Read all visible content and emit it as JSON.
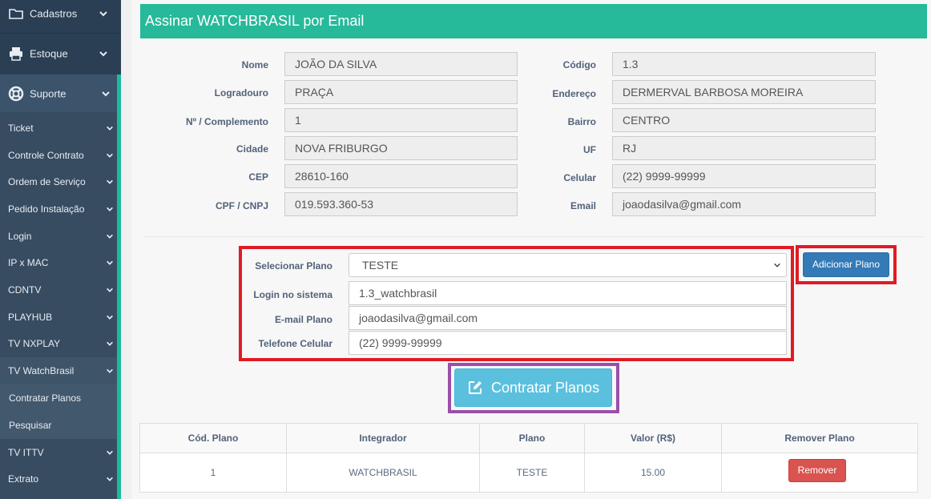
{
  "sidebar": {
    "top_items": [
      {
        "label": "Cadastros",
        "icon": "folder-icon"
      },
      {
        "label": "Estoque",
        "icon": "printer-icon"
      },
      {
        "label": "Suporte",
        "icon": "life-ring-icon"
      }
    ],
    "sub_items": [
      {
        "label": "Ticket"
      },
      {
        "label": "Controle Contrato"
      },
      {
        "label": "Ordem de Serviço"
      },
      {
        "label": "Pedido Instalação"
      },
      {
        "label": "Login"
      },
      {
        "label": "IP x MAC"
      },
      {
        "label": "CDNTV"
      },
      {
        "label": "PLAYHUB"
      },
      {
        "label": "TV NXPLAY"
      },
      {
        "label": "TV WatchBrasil"
      },
      {
        "label": "Contratar Planos"
      },
      {
        "label": "Pesquisar"
      },
      {
        "label": "TV ITTV"
      },
      {
        "label": "Extrato"
      }
    ]
  },
  "header": {
    "title": "Assinar WATCHBRASIL por Email"
  },
  "customer": {
    "left": [
      {
        "label": "Nome",
        "value": "JOÃO DA SILVA"
      },
      {
        "label": "Logradouro",
        "value": "PRAÇA"
      },
      {
        "label": "Nº / Complemento",
        "value": "1"
      },
      {
        "label": "Cidade",
        "value": "NOVA FRIBURGO"
      },
      {
        "label": "CEP",
        "value": "28610-160"
      },
      {
        "label": "CPF / CNPJ",
        "value": "019.593.360-53"
      }
    ],
    "right": [
      {
        "label": "Código",
        "value": "1.3"
      },
      {
        "label": "Endereço",
        "value": "DERMERVAL BARBOSA MOREIRA"
      },
      {
        "label": "Bairro",
        "value": "CENTRO"
      },
      {
        "label": "UF",
        "value": "RJ"
      },
      {
        "label": "Celular",
        "value": "(22) 9999-99999"
      },
      {
        "label": "Email",
        "value": "joaodasilva@gmail.com"
      }
    ]
  },
  "plan_form": {
    "select_label": "Selecionar Plano",
    "select_value": "TESTE",
    "login_label": "Login no sistema",
    "login_value": "1.3_watchbrasil",
    "email_label": "E-mail Plano",
    "email_value": "joaodasilva@gmail.com",
    "phone_label": "Telefone Celular",
    "phone_value": "(22) 9999-99999",
    "add_button": "Adicionar Plano",
    "contract_button": "Contratar Planos"
  },
  "table": {
    "headers": [
      "Cód. Plano",
      "Integrador",
      "Plano",
      "Valor (R$)",
      "Remover Plano"
    ],
    "rows": [
      {
        "cod": "1",
        "integrador": "WATCHBRASIL",
        "plano": "TESTE",
        "valor": "15.00",
        "remove_label": "Remover"
      }
    ]
  },
  "colors": {
    "header": "#26b99a",
    "sidebar": "#2a3f54",
    "primary_button": "#337ab7",
    "info_button": "#5bc0de",
    "danger_button": "#d9534f",
    "highlight_red": "#e01b24",
    "highlight_purple": "#9b4fa8"
  }
}
